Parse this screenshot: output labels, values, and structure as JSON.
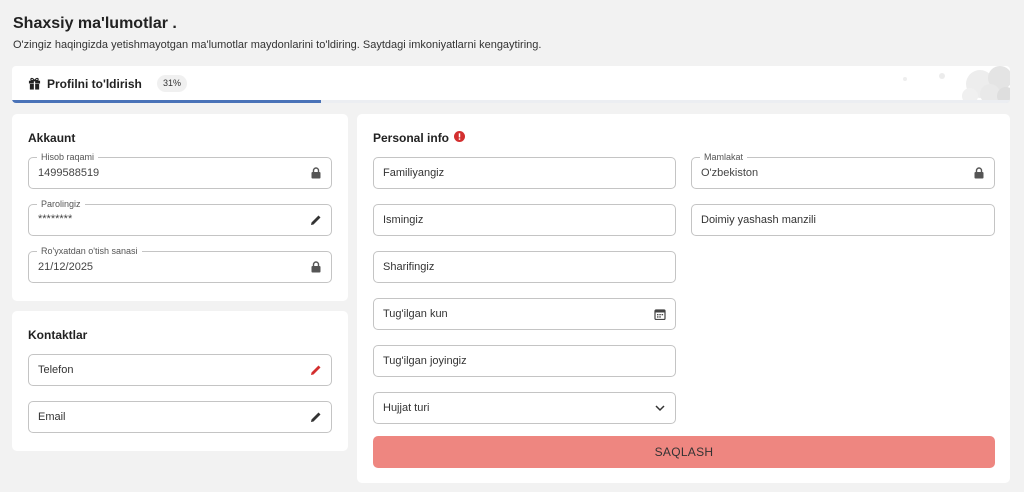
{
  "page": {
    "title": "Shaxsiy ma'lumotlar .",
    "subtitle": "O'zingiz haqingizda yetishmayotgan ma'lumotlar maydonlarini to'ldiring. Saytdagi imkoniyatlarni kengaytiring."
  },
  "progress": {
    "label": "Profilni to'ldirish",
    "percent_text": "31%",
    "value": 0.31,
    "bar_color": "#4a73b8"
  },
  "account": {
    "title": "Akkaunt",
    "account_number": {
      "label": "Hisob raqami",
      "value": "1499588519",
      "icon": "lock-icon"
    },
    "password": {
      "label": "Parolingiz",
      "value": "********",
      "icon": "pencil-icon"
    },
    "registration_date": {
      "label": "Ro'yxatdan o'tish sanasi",
      "value": "21/12/2025",
      "icon": "lock-icon"
    }
  },
  "contacts": {
    "title": "Kontaktlar",
    "phone": {
      "placeholder": "Telefon",
      "icon": "pencil-icon",
      "icon_color": "#d32f2f"
    },
    "email": {
      "placeholder": "Email",
      "icon": "pencil-icon"
    }
  },
  "personal": {
    "title": "Personal info",
    "info_icon_color": "#d32f2f",
    "surname": {
      "placeholder": "Familiyangiz"
    },
    "name": {
      "placeholder": "Ismingiz"
    },
    "patronymic": {
      "placeholder": "Sharifingiz"
    },
    "birth_date": {
      "placeholder": "Tug'ilgan kun",
      "icon": "calendar-icon"
    },
    "birth_place": {
      "placeholder": "Tug'ilgan joyingiz"
    },
    "document_type": {
      "selected": "Hujjat turi",
      "icon": "chevron-down-icon"
    },
    "country": {
      "label": "Mamlakat",
      "value": "O'zbekiston",
      "icon": "lock-icon"
    },
    "address": {
      "placeholder": "Doimiy yashash manzili"
    },
    "save_label": "SAQLASH",
    "save_color": "#ee8680"
  }
}
